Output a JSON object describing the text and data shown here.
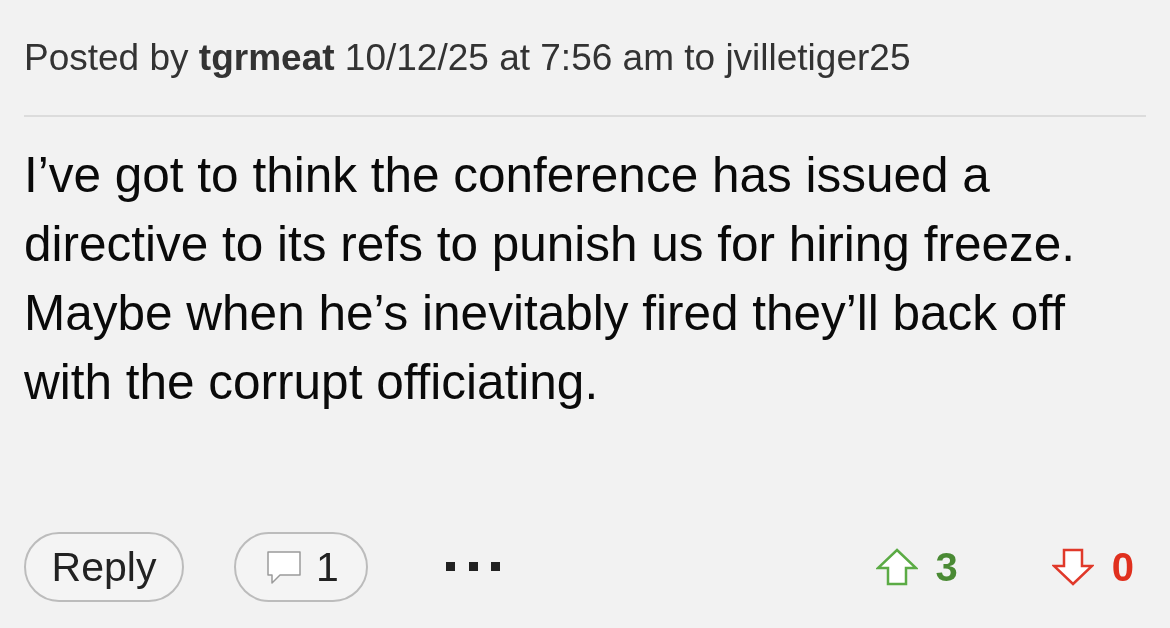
{
  "post": {
    "byline": "Posted by **tgrmeat** 10/12/25 at 7:56 am to jvilletiger25",
    "body": "I’ve got to think the conference has issued a directive to its refs to punish us for hiring freeze. Maybe when he’s inevitably fired they’ll back off with the corrupt officiating."
  },
  "actions": {
    "reply": "Reply",
    "reply_count": "1"
  },
  "votes": {
    "up": "3",
    "down": "0"
  }
}
